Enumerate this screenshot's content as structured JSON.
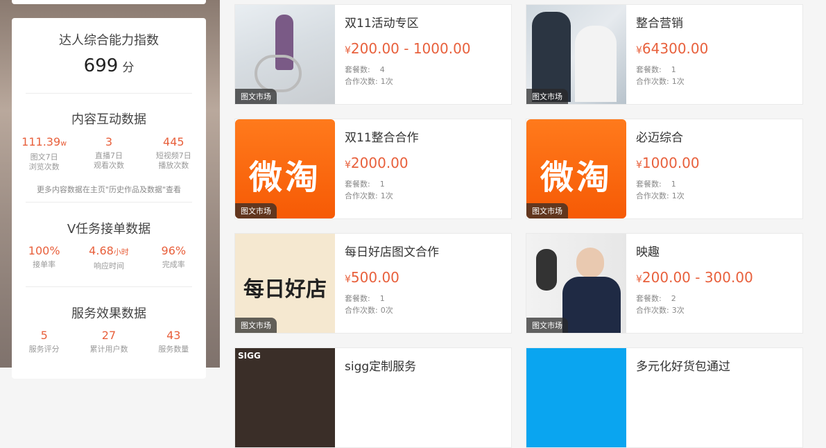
{
  "left": {
    "ability": {
      "title": "达人综合能力指数",
      "score": "699",
      "unit": "分"
    },
    "content": {
      "title": "内容互动数据",
      "stats": [
        {
          "value": "111.39",
          "suffix": "w",
          "label1": "图文7日",
          "label2": "浏览次数"
        },
        {
          "value": "3",
          "suffix": "",
          "label1": "直播7日",
          "label2": "观看次数"
        },
        {
          "value": "445",
          "suffix": "",
          "label1": "短视频7日",
          "label2": "播放次数"
        }
      ],
      "note": "更多内容数据在主页\"历史作品及数据\"查看"
    },
    "vtask": {
      "title": "V任务接单数据",
      "stats": [
        {
          "value": "100%",
          "suffix": "",
          "label": "接单率"
        },
        {
          "value": "4.68",
          "suffix": "小时",
          "label": "响应时间"
        },
        {
          "value": "96%",
          "suffix": "",
          "label": "完成率"
        }
      ]
    },
    "service": {
      "title": "服务效果数据",
      "stats": [
        {
          "value": "5",
          "label": "服务评分"
        },
        {
          "value": "27",
          "label": "累计用户数"
        },
        {
          "value": "43",
          "label": "服务数量"
        }
      ]
    }
  },
  "cards": [
    {
      "title": "双11活动专区",
      "yen": "¥",
      "price": "200.00 - 1000.00",
      "pkg_label": "套餐数:",
      "pkg": "4",
      "coop_label": "合作次数:",
      "coop": "1次",
      "tag": "图文市场"
    },
    {
      "title": "整合营销",
      "yen": "¥",
      "price": "64300.00",
      "pkg_label": "套餐数:",
      "pkg": "1",
      "coop_label": "合作次数:",
      "coop": "1次",
      "tag": "图文市场"
    },
    {
      "title": "双11整合合作",
      "yen": "¥",
      "price": "2000.00",
      "pkg_label": "套餐数:",
      "pkg": "1",
      "coop_label": "合作次数:",
      "coop": "1次",
      "tag": "图文市场",
      "logo": "微淘"
    },
    {
      "title": "必迈综合",
      "yen": "¥",
      "price": "1000.00",
      "pkg_label": "套餐数:",
      "pkg": "1",
      "coop_label": "合作次数:",
      "coop": "1次",
      "tag": "图文市场",
      "logo": "微淘"
    },
    {
      "title": "每日好店图文合作",
      "yen": "¥",
      "price": "500.00",
      "pkg_label": "套餐数:",
      "pkg": "1",
      "coop_label": "合作次数:",
      "coop": "0次",
      "tag": "图文市场",
      "logo": "每日好店"
    },
    {
      "title": "映趣",
      "yen": "¥",
      "price": "200.00 - 300.00",
      "pkg_label": "套餐数:",
      "pkg": "2",
      "coop_label": "合作次数:",
      "coop": "3次",
      "tag": "图文市场"
    },
    {
      "title": "sigg定制服务",
      "tag": "",
      "logo": "SIGG"
    },
    {
      "title": "多元化好货包通过",
      "tag": ""
    }
  ]
}
